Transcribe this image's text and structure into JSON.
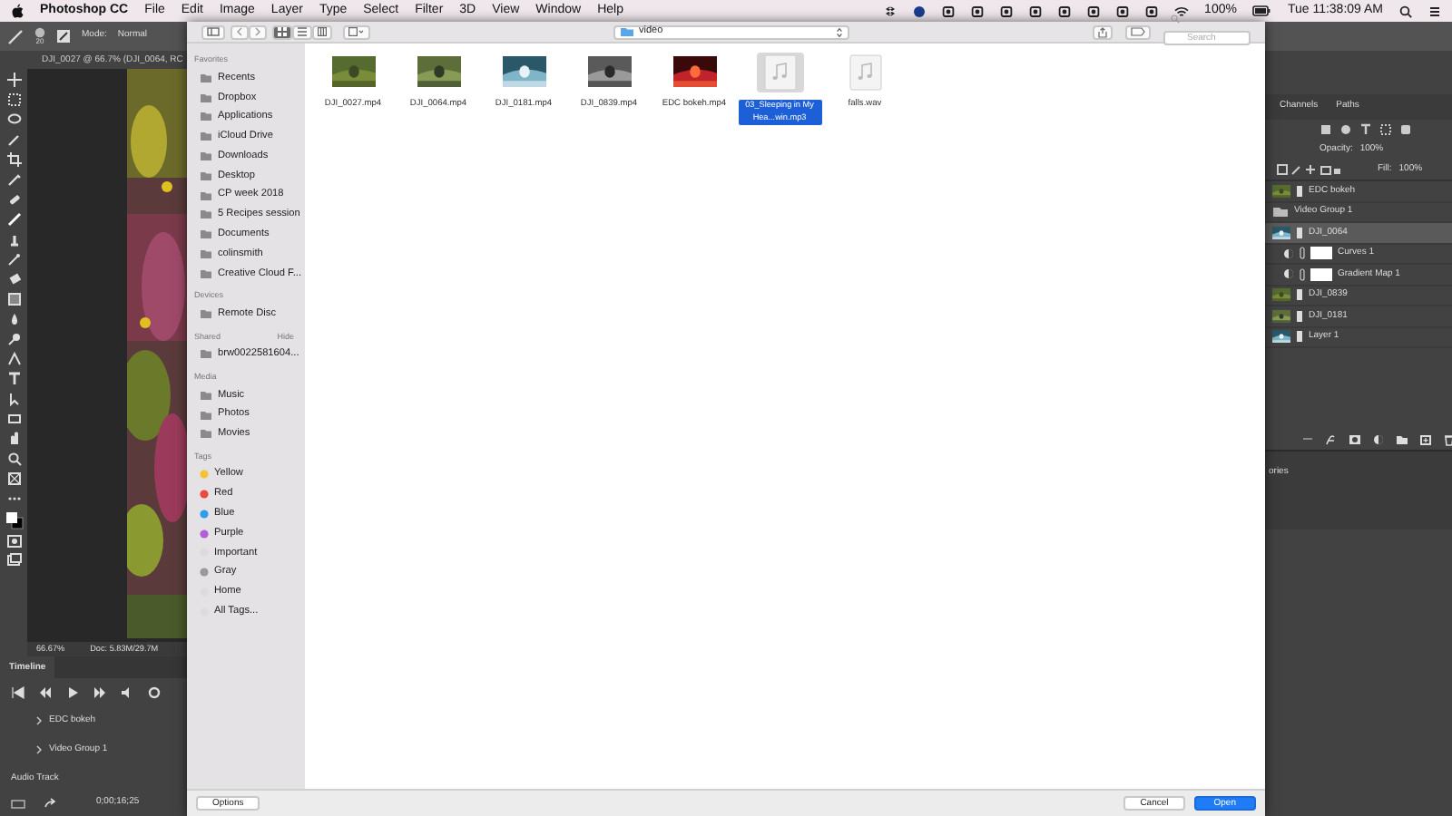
{
  "menu_bar": {
    "app": "Photoshop CC",
    "menus": [
      "File",
      "Edit",
      "Image",
      "Layer",
      "Type",
      "Select",
      "Filter",
      "3D",
      "View",
      "Window",
      "Help"
    ],
    "battery": "100%",
    "clock": "Tue 11:38:09 AM"
  },
  "options_bar": {
    "brush_size": "20",
    "mode_label": "Mode:",
    "mode": "Normal"
  },
  "document_tab": "DJI_0027 @ 66.7% (DJI_0064, RC",
  "status_bar": {
    "zoom": "66.67%",
    "doc": "Doc: 5.83M/29.7M"
  },
  "timeline": {
    "title": "Timeline",
    "tracks": [
      "EDC bokeh",
      "Video Group 1"
    ],
    "audio": "Audio Track",
    "timecode": "0;00;16;25"
  },
  "layers_panel": {
    "tabs": [
      {
        "label": "Channels",
        "selected": false
      },
      {
        "label": "Paths",
        "selected": false
      }
    ],
    "opacity_label": "Opacity:",
    "opacity": "100%",
    "fill_label": "Fill:",
    "fill": "100%",
    "layers": [
      {
        "name": "EDC bokeh",
        "kind": "video",
        "selected": false
      },
      {
        "name": "Video Group 1",
        "kind": "group",
        "selected": false
      },
      {
        "name": "DJI_0064",
        "kind": "video",
        "selected": true
      },
      {
        "name": "Curves 1",
        "kind": "adjustment",
        "selected": false
      },
      {
        "name": "Gradient Map 1",
        "kind": "adjustment",
        "selected": false
      },
      {
        "name": "DJI_0839",
        "kind": "video",
        "selected": false
      },
      {
        "name": "DJI_0181",
        "kind": "video",
        "selected": false
      },
      {
        "name": "Layer 1",
        "kind": "video",
        "selected": false
      }
    ]
  },
  "lower_panel": {
    "text": "ories"
  },
  "dialog": {
    "location": "video",
    "search_placeholder": "Search",
    "sidebar": [
      {
        "title": "Favorites",
        "items": [
          {
            "label": "Recents"
          },
          {
            "label": "Dropbox"
          },
          {
            "label": "Applications"
          },
          {
            "label": "iCloud Drive"
          },
          {
            "label": "Downloads"
          },
          {
            "label": "Desktop"
          },
          {
            "label": "CP week 2018"
          },
          {
            "label": "5 Recipes session"
          },
          {
            "label": "Documents"
          },
          {
            "label": "colinsmith"
          },
          {
            "label": "Creative Cloud F..."
          }
        ]
      },
      {
        "title": "Devices",
        "items": [
          {
            "label": "Remote Disc"
          }
        ]
      },
      {
        "title": "Shared",
        "action": "Hide",
        "items": [
          {
            "label": "brw0022581604..."
          }
        ]
      },
      {
        "title": "Media",
        "items": [
          {
            "label": "Music"
          },
          {
            "label": "Photos"
          },
          {
            "label": "Movies"
          }
        ]
      },
      {
        "title": "Tags",
        "items": [
          {
            "label": "Yellow",
            "color": "#f5c330"
          },
          {
            "label": "Red",
            "color": "#e94b3c"
          },
          {
            "label": "Blue",
            "color": "#2f9ee9"
          },
          {
            "label": "Purple",
            "color": "#b35fd8"
          },
          {
            "label": "Important",
            "color": "#dcdcdc"
          },
          {
            "label": "Gray",
            "color": "#9a9a9a"
          },
          {
            "label": "Home",
            "color": "#dcdcdc"
          },
          {
            "label": "All Tags...",
            "color": "#dcdcdc"
          }
        ]
      }
    ],
    "files": [
      {
        "name": "DJI_0027.mp4",
        "kind": "video",
        "selected": false
      },
      {
        "name": "DJI_0064.mp4",
        "kind": "video",
        "selected": false
      },
      {
        "name": "DJI_0181.mp4",
        "kind": "video",
        "selected": false
      },
      {
        "name": "DJI_0839.mp4",
        "kind": "video",
        "selected": false
      },
      {
        "name": "EDC bokeh.mp4",
        "kind": "video",
        "selected": false
      },
      {
        "name": "03_Sleeping in My Hea...win.mp3",
        "kind": "audio",
        "selected": true
      },
      {
        "name": "falls.wav",
        "kind": "audio",
        "selected": false
      }
    ],
    "buttons": {
      "options": "Options",
      "cancel": "Cancel",
      "open": "Open"
    }
  }
}
